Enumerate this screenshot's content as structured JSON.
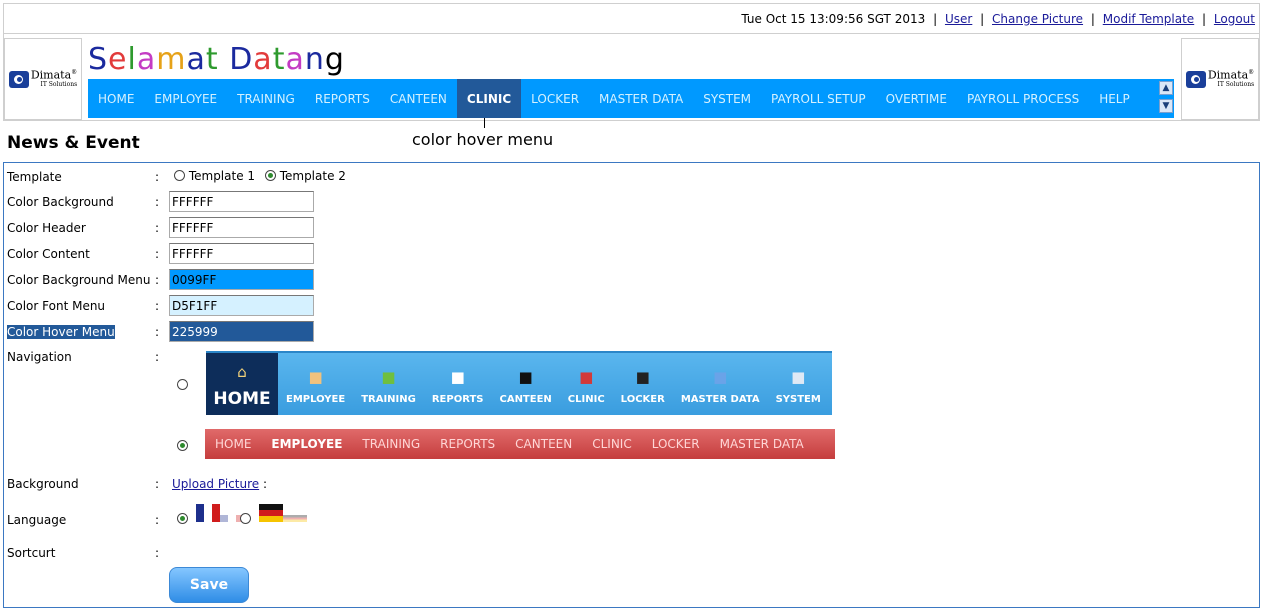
{
  "topbar": {
    "datetime": "Tue Oct 15 13:09:56 SGT 2013",
    "links": [
      "User",
      "Change Picture",
      "Modif Template",
      "Logout"
    ],
    "separator": "|"
  },
  "logo": {
    "name": "Dimata",
    "sub": "IT Solutions",
    "reg": "®"
  },
  "welcome": {
    "letters": [
      "S",
      "e",
      "l",
      "a",
      "m",
      "a",
      "t",
      " ",
      "D",
      "a",
      "t",
      "a",
      "n",
      "g"
    ],
    "colors": [
      "#1b2a9e",
      "#e23b3b",
      "#2e9a2e",
      "#c43cc4",
      "#e6a218",
      "#1b2a9e",
      "#2e9a2e",
      "#000000",
      "#1b2a9e",
      "#e23b3b",
      "#2e9a2e",
      "#c43cc4",
      "#1b2a9e",
      "#000000"
    ]
  },
  "menu": {
    "items": [
      "HOME",
      "EMPLOYEE",
      "TRAINING",
      "REPORTS",
      "CANTEEN",
      "CLINIC",
      "LOCKER",
      "MASTER DATA",
      "SYSTEM",
      "PAYROLL SETUP",
      "OVERTIME",
      "PAYROLL PROCESS",
      "HELP"
    ],
    "active_index": 5,
    "bg_color": "#0099ff",
    "font_color": "#d5f1ff",
    "hover_color": "#225999"
  },
  "callout": "color hover menu",
  "page_title": "News & Event",
  "form": {
    "template": {
      "label": "Template",
      "options": [
        "Template 1",
        "Template 2"
      ],
      "selected": 1
    },
    "color_background": {
      "label": "Color Background",
      "value": "FFFFFF"
    },
    "color_header": {
      "label": "Color Header",
      "value": "FFFFFF"
    },
    "color_content": {
      "label": "Color Content",
      "value": "FFFFFF"
    },
    "color_background_menu": {
      "label": "Color Background Menu",
      "value": "0099FF"
    },
    "color_font_menu": {
      "label": "Color Font Menu",
      "value": "D5F1FF"
    },
    "color_hover_menu": {
      "label": "Color Hover Menu",
      "value": "225999"
    },
    "navigation": {
      "label": "Navigation",
      "style1": {
        "home": "HOME",
        "items": [
          "EMPLOYEE",
          "TRAINING",
          "REPORTS",
          "CANTEEN",
          "CLINIC",
          "LOCKER",
          "MASTER DATA",
          "SYSTEM"
        ],
        "icons": [
          "employee-icon",
          "training-icon",
          "reports-icon",
          "canteen-icon",
          "clinic-icon",
          "locker-icon",
          "master-data-icon",
          "system-icon"
        ],
        "selected": false
      },
      "style2": {
        "items": [
          "HOME",
          "EMPLOYEE",
          "TRAINING",
          "REPORTS",
          "CANTEEN",
          "CLINIC",
          "LOCKER",
          "MASTER DATA"
        ],
        "active_index": 1,
        "selected": true
      }
    },
    "background": {
      "label": "Background",
      "link": "Upload Picture",
      "suffix": ":"
    },
    "language": {
      "label": "Language",
      "options": [
        "french-flag-icon",
        "german-flag-icon"
      ],
      "selected": 0
    },
    "sortcurt": {
      "label": "Sortcurt"
    },
    "colon": ":",
    "save_label": "Save"
  }
}
